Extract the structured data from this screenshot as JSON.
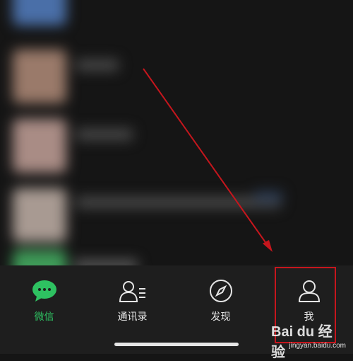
{
  "tabbar": {
    "tabs": [
      {
        "label": "微信",
        "icon": "chat-bubble-icon",
        "active": true
      },
      {
        "label": "通讯录",
        "icon": "contacts-icon",
        "active": false
      },
      {
        "label": "发现",
        "icon": "compass-icon",
        "active": false
      },
      {
        "label": "我",
        "icon": "person-icon",
        "active": false
      }
    ]
  },
  "annotation": {
    "arrow_color": "#c6161d",
    "highlight_target": "tab-me"
  },
  "colors": {
    "accent": "#2ec161",
    "background": "#151515",
    "tabbar_bg": "#1e1e1e"
  },
  "watermark": {
    "brand": "Bai du 经验",
    "url": "jingyan.baidu.com"
  }
}
